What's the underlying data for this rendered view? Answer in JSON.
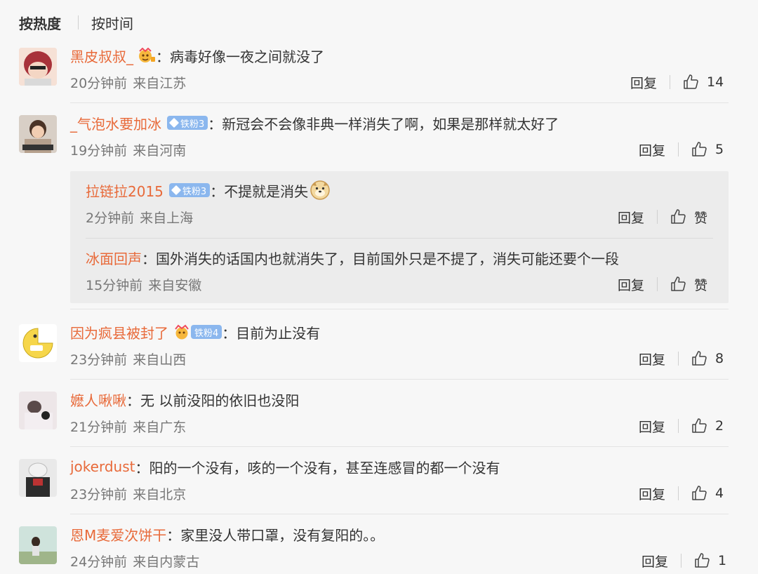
{
  "sort": {
    "hot": "按热度",
    "time": "按时间"
  },
  "labels": {
    "reply": "回复",
    "like_word": "赞"
  },
  "comments": [
    {
      "user": "黑皮叔叔_",
      "text": "病毒好像一夜之间就没了",
      "time": "20分钟前",
      "location": "来自江苏",
      "likes": "14"
    },
    {
      "user": "_气泡水要加冰",
      "badge": "铁粉3",
      "text": "新冠会不会像非典一样消失了啊，如果是那样就太好了",
      "time": "19分钟前",
      "location": "来自河南",
      "likes": "5"
    },
    {
      "user": "因为疯县被封了",
      "badge": "铁粉4",
      "text": "目前为止没有",
      "time": "23分钟前",
      "location": "来自山西",
      "likes": "8"
    },
    {
      "user": "嬷人啾啾",
      "text": "无 以前没阳的依旧也没阳",
      "time": "21分钟前",
      "location": "来自广东",
      "likes": "2"
    },
    {
      "user": "jokerdust",
      "text": "阳的一个没有，咳的一个没有，甚至连感冒的都一个没有",
      "time": "23分钟前",
      "location": "来自北京",
      "likes": "4"
    },
    {
      "user": "恩M麦爱次饼干",
      "text": "家里没人带口罩，没有复阳的。。",
      "time": "24分钟前",
      "location": "来自内蒙古",
      "likes": "1"
    }
  ],
  "replies": [
    {
      "user": "拉链拉2015",
      "badge": "铁粉3",
      "text": "不提就是消失",
      "time": "2分钟前",
      "location": "来自上海"
    },
    {
      "user": "冰面回声",
      "text": "国外消失的话国内也就消失了，目前国外只是不提了，消失可能还要个一段",
      "time": "15分钟前",
      "location": "来自安徽"
    }
  ],
  "colors": {
    "username": "#e86a3a",
    "badge": "#8bb7ee",
    "background": "#f7f7f7",
    "reply_box": "#ececec"
  }
}
